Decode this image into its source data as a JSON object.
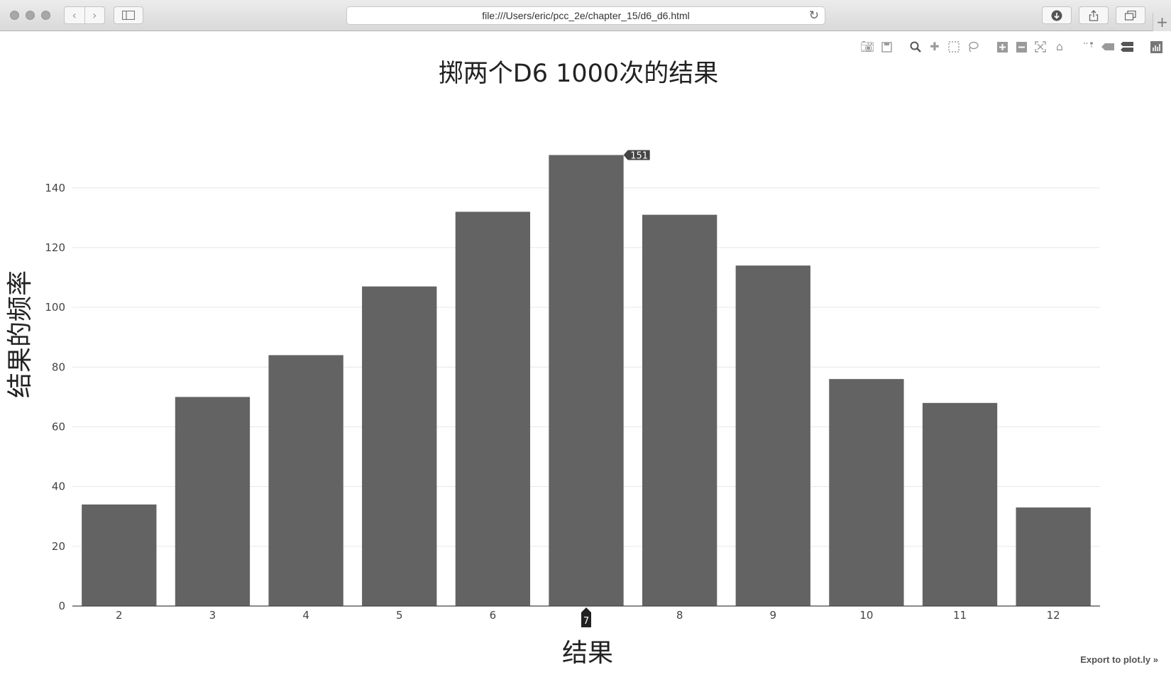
{
  "browser": {
    "url": "file:///Users/eric/pcc_2e/chapter_15/d6_d6.html"
  },
  "modebar": {
    "icons": [
      "camera-icon",
      "save-icon",
      "zoom-icon",
      "pan-icon",
      "box-select-icon",
      "lasso-icon",
      "zoom-in-icon",
      "zoom-out-icon",
      "autoscale-icon",
      "reset-axes-icon",
      "spike-lines-icon",
      "hover-closest-icon",
      "hover-compare-icon",
      "plotly-logo-icon"
    ]
  },
  "export_link": "Export to plot.ly »",
  "chart_data": {
    "type": "bar",
    "title": "掷两个D6 1000次的结果",
    "xlabel": "结果",
    "ylabel": "结果的频率",
    "categories": [
      "2",
      "3",
      "4",
      "5",
      "6",
      "7",
      "8",
      "9",
      "10",
      "11",
      "12"
    ],
    "values": [
      34,
      70,
      84,
      107,
      132,
      151,
      131,
      114,
      76,
      68,
      33
    ],
    "yticks": [
      0,
      20,
      40,
      60,
      80,
      100,
      120,
      140
    ],
    "ylim": [
      0,
      158
    ],
    "grid": true,
    "bar_color": "#636363",
    "hover": {
      "category": "7",
      "value": "151"
    }
  }
}
